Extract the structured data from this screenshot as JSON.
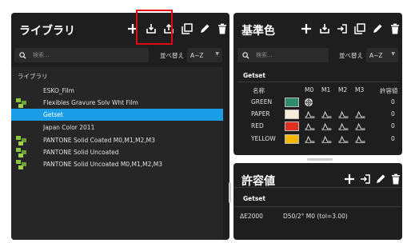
{
  "library": {
    "title": "ライブラリ",
    "search_placeholder": "検索...",
    "sort_label": "並べ替え",
    "sort_value": "A~Z",
    "root_label": "ライブラリ",
    "items": [
      {
        "label": "ESKO_Film",
        "icon": "none"
      },
      {
        "label": "Flexibles Gravure Solv Wht Film",
        "icon": "library-icon"
      },
      {
        "label": "Getset",
        "icon": "none",
        "selected": true
      },
      {
        "label": "Japan Color 2011",
        "icon": "none"
      },
      {
        "label": "PANTONE Solid Coated M0,M1,M2,M3",
        "icon": "library-icon"
      },
      {
        "label": "PANTONE Solid Uncoated",
        "icon": "library-icon"
      },
      {
        "label": "PANTONE Solid Uncoated M0,M1,M2,M3",
        "icon": "library-icon"
      }
    ],
    "toolbar_icons": [
      "plus-icon",
      "import-icon",
      "export-icon",
      "duplicate-icon",
      "edit-icon",
      "delete-icon"
    ]
  },
  "reference": {
    "title": "基準色",
    "search_placeholder": "検索...",
    "sort_label": "並べ替え",
    "sort_value": "A~Z",
    "section_title": "Getset",
    "columns": [
      "名称",
      "M0",
      "M1",
      "M2",
      "M3",
      "許容値"
    ],
    "rows": [
      {
        "name": "GREEN",
        "color": "#2e8b6b",
        "tol": "0",
        "m0": "target-icon"
      },
      {
        "name": "PAPER",
        "color": "#f7eddc",
        "tol": "0",
        "m0": "curve-icon"
      },
      {
        "name": "RED",
        "color": "#e0301e",
        "tol": "0",
        "m0": "curve-icon"
      },
      {
        "name": "YELLOW",
        "color": "#f5b800",
        "tol": "0",
        "m0": "curve-icon"
      }
    ],
    "toolbar_icons": [
      "plus-icon",
      "import-icon",
      "login-icon",
      "duplicate-icon",
      "edit-icon",
      "delete-icon"
    ]
  },
  "tolerance": {
    "title": "許容値",
    "section_title": "Getset",
    "rows": [
      {
        "name": "ΔE2000",
        "value": "D50/2° M0 (tol=3.00)"
      }
    ],
    "toolbar_icons": [
      "plus-icon",
      "login-icon",
      "edit-icon",
      "delete-icon"
    ]
  },
  "colors": {
    "panel": "#1e1e1e",
    "selection": "#1b9ee6",
    "highlight": "#e30613",
    "library_icon": "#8cc63f"
  }
}
